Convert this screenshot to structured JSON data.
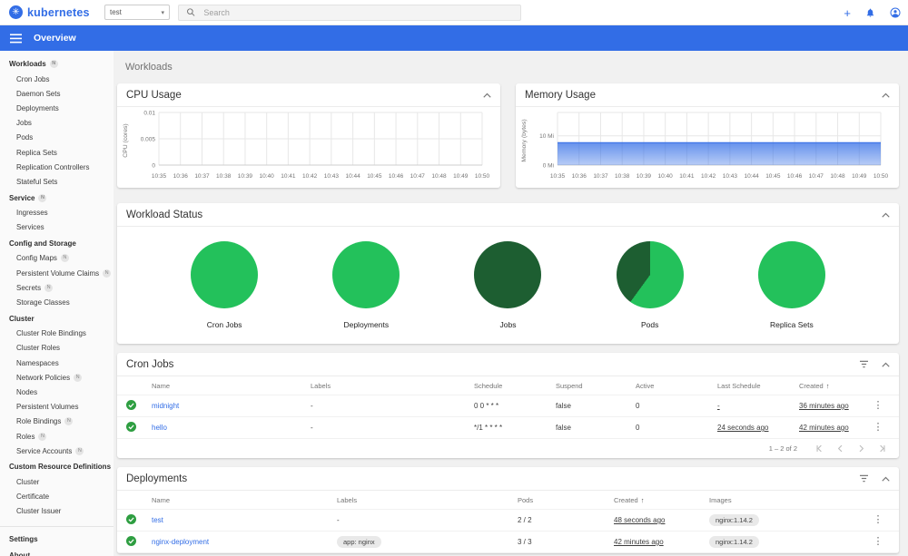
{
  "colors": {
    "brand": "#326de6",
    "link": "#326de6",
    "success_light": "#23c15b",
    "success_dark": "#1d5e31",
    "toolbar": "#326de6"
  },
  "header": {
    "logo_text": "kubernetes",
    "namespace": {
      "value": "test"
    },
    "search": {
      "placeholder": "Search"
    }
  },
  "toolbar": {
    "title": "Overview"
  },
  "sidebar": {
    "groups": [
      {
        "header": "Workloads",
        "badge": "N",
        "items": [
          {
            "label": "Cron Jobs"
          },
          {
            "label": "Daemon Sets"
          },
          {
            "label": "Deployments"
          },
          {
            "label": "Jobs"
          },
          {
            "label": "Pods"
          },
          {
            "label": "Replica Sets"
          },
          {
            "label": "Replication Controllers"
          },
          {
            "label": "Stateful Sets"
          }
        ]
      },
      {
        "header": "Service",
        "badge": "N",
        "items": [
          {
            "label": "Ingresses"
          },
          {
            "label": "Services"
          }
        ]
      },
      {
        "header": "Config and Storage",
        "badge": "",
        "items": [
          {
            "label": "Config Maps",
            "badge": "N"
          },
          {
            "label": "Persistent Volume Claims",
            "badge": "N"
          },
          {
            "label": "Secrets",
            "badge": "N"
          },
          {
            "label": "Storage Classes"
          }
        ]
      },
      {
        "header": "Cluster",
        "badge": "",
        "items": [
          {
            "label": "Cluster Role Bindings"
          },
          {
            "label": "Cluster Roles"
          },
          {
            "label": "Namespaces"
          },
          {
            "label": "Network Policies",
            "badge": "N"
          },
          {
            "label": "Nodes"
          },
          {
            "label": "Persistent Volumes"
          },
          {
            "label": "Role Bindings",
            "badge": "N"
          },
          {
            "label": "Roles",
            "badge": "N"
          },
          {
            "label": "Service Accounts",
            "badge": "N"
          }
        ]
      },
      {
        "header": "Custom Resource Definitions",
        "badge": "",
        "items": [
          {
            "label": "Cluster"
          },
          {
            "label": "Certificate"
          },
          {
            "label": "Cluster Issuer"
          }
        ]
      }
    ],
    "footer": [
      {
        "label": "Settings"
      },
      {
        "label": "About"
      }
    ]
  },
  "page": {
    "title": "Workloads"
  },
  "cards": {
    "cpu": {
      "title": "CPU Usage"
    },
    "memory": {
      "title": "Memory Usage"
    },
    "workload_status": {
      "title": "Workload Status"
    },
    "cron_jobs": {
      "title": "Cron Jobs",
      "columns": [
        "Name",
        "Labels",
        "Schedule",
        "Suspend",
        "Active",
        "Last Schedule",
        "Created"
      ],
      "sorted_column": "Created",
      "sort_indicator": "↑",
      "rows": [
        {
          "name": "midnight",
          "labels": "-",
          "schedule": "0 0 * * *",
          "suspend": "false",
          "active": "0",
          "last_schedule": "-",
          "created": "36 minutes ago"
        },
        {
          "name": "hello",
          "labels": "-",
          "schedule": "*/1 * * * *",
          "suspend": "false",
          "active": "0",
          "last_schedule": "24 seconds ago",
          "created": "42 minutes ago"
        }
      ],
      "pagination": {
        "label": "1 – 2 of 2"
      }
    },
    "deployments": {
      "title": "Deployments",
      "columns": [
        "Name",
        "Labels",
        "Pods",
        "Created",
        "Images"
      ],
      "sorted_column": "Created",
      "sort_indicator": "↑",
      "rows": [
        {
          "name": "test",
          "labels": "-",
          "labels_is_chip": false,
          "pods": "2 / 2",
          "created": "48 seconds ago",
          "images": "nginx:1.14.2"
        },
        {
          "name": "nginx-deployment",
          "labels": "app: nginx",
          "labels_is_chip": true,
          "pods": "3 / 3",
          "created": "42 minutes ago",
          "images": "nginx:1.14.2"
        }
      ]
    }
  },
  "chart_data": [
    {
      "type": "line",
      "title": "CPU Usage",
      "ylabel": "CPU (cores)",
      "x": [
        "10:35",
        "10:36",
        "10:37",
        "10:38",
        "10:39",
        "10:40",
        "10:41",
        "10:42",
        "10:43",
        "10:44",
        "10:45",
        "10:46",
        "10:47",
        "10:48",
        "10:49",
        "10:50"
      ],
      "yticks": [
        {
          "label": "0",
          "value": 0
        },
        {
          "label": "0.005",
          "value": 0.005
        },
        {
          "label": "0.01",
          "value": 0.01
        }
      ],
      "axis_max": 0.01,
      "grid": true,
      "series": []
    },
    {
      "type": "area",
      "title": "Memory Usage",
      "ylabel": "Memory (bytes)",
      "x": [
        "10:35",
        "10:36",
        "10:37",
        "10:38",
        "10:39",
        "10:40",
        "10:41",
        "10:42",
        "10:43",
        "10:44",
        "10:45",
        "10:46",
        "10:47",
        "10:48",
        "10:49",
        "10:50"
      ],
      "yticks": [
        {
          "label": "0 Mi",
          "value": 0
        },
        {
          "label": "10 Mi",
          "value": 10
        }
      ],
      "axis_max": 18,
      "grid": true,
      "series": [
        {
          "name": "memory-usage-mi",
          "color": "#326de6",
          "values": [
            7.7,
            7.7,
            7.7,
            7.7,
            7.7,
            7.7,
            7.7,
            7.7,
            7.7,
            7.7,
            7.7,
            7.7,
            7.7,
            7.7,
            7.7,
            7.7
          ]
        }
      ]
    },
    {
      "type": "pie",
      "title": "Workload Status",
      "pies": [
        {
          "label": "Cron Jobs",
          "slices": [
            {
              "color": "#23c15b",
              "fraction": 1
            }
          ]
        },
        {
          "label": "Deployments",
          "slices": [
            {
              "color": "#23c15b",
              "fraction": 1
            }
          ]
        },
        {
          "label": "Jobs",
          "slices": [
            {
              "color": "#1d5e31",
              "fraction": 1
            }
          ]
        },
        {
          "label": "Pods",
          "slices": [
            {
              "color": "#23c15b",
              "fraction": 0.6
            },
            {
              "color": "#1d5e31",
              "fraction": 0.4
            }
          ]
        },
        {
          "label": "Replica Sets",
          "slices": [
            {
              "color": "#23c15b",
              "fraction": 1
            }
          ]
        }
      ]
    }
  ]
}
